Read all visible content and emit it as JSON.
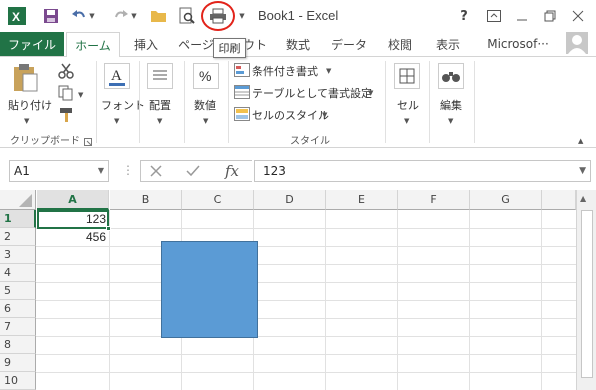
{
  "window": {
    "title": "Book1 - Excel",
    "help": "?",
    "tooltip": "印刷"
  },
  "tabs": {
    "file": "ファイル",
    "items": [
      "ホーム",
      "挿入",
      "ページ",
      "ウト",
      "数式",
      "データ",
      "校閲",
      "表示",
      "Microsof···"
    ]
  },
  "ribbon": {
    "clipboard": {
      "paste": "貼り付け",
      "group": "クリップボード"
    },
    "font": {
      "label": "フォント"
    },
    "alignment": {
      "label": "配置"
    },
    "number": {
      "label": "数値"
    },
    "styles": {
      "conditional": "条件付き書式",
      "table": "テーブルとして書式設定",
      "cell_styles": "セルのスタイル",
      "group": "スタイル"
    },
    "cells": {
      "label": "セル"
    },
    "editing": {
      "label": "編集"
    }
  },
  "formula_bar": {
    "namebox": "A1",
    "fx": "fx",
    "value": "123"
  },
  "grid": {
    "columns": [
      "A",
      "B",
      "C",
      "D",
      "E",
      "F",
      "G"
    ],
    "rows": [
      "1",
      "2",
      "3",
      "4",
      "5",
      "6",
      "7",
      "8",
      "9",
      "10"
    ],
    "cells": {
      "A1": "123",
      "A2": "456"
    }
  },
  "colors": {
    "accent": "#217346",
    "shape_fill": "#5b9bd5",
    "highlight_circle": "#e2231a"
  }
}
